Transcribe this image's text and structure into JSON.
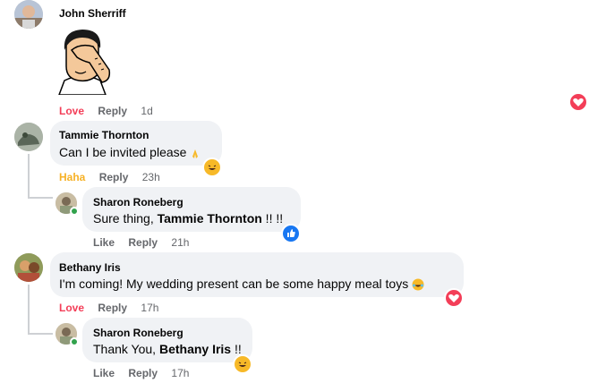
{
  "comments": [
    {
      "author": "John Sherriff",
      "actions": {
        "reaction": "Love",
        "reply": "Reply",
        "time": "1d"
      }
    },
    {
      "author": "Tammie Thornton",
      "text": "Can I be invited please",
      "actions": {
        "reaction": "Haha",
        "reply": "Reply",
        "time": "23h"
      },
      "reply": {
        "author": "Sharon Roneberg",
        "text_prefix": "Sure thing, ",
        "mention": "Tammie Thornton",
        "text_suffix": " !! !!",
        "actions": {
          "reaction": "Like",
          "reply": "Reply",
          "time": "21h"
        }
      }
    },
    {
      "author": "Bethany Iris",
      "text": "I'm coming! My wedding present can be some happy meal toys",
      "actions": {
        "reaction": "Love",
        "reply": "Reply",
        "time": "17h"
      },
      "reply": {
        "author": "Sharon Roneberg",
        "text_prefix": "Thank You, ",
        "mention": "Bethany Iris",
        "text_suffix": " !!",
        "actions": {
          "reaction": "Like",
          "reply": "Reply",
          "time": "17h"
        }
      }
    }
  ],
  "icons": {
    "sticker": "facepalm-sticker",
    "love": "heart-reaction-icon",
    "haha": "haha-reaction-icon",
    "like": "like-reaction-icon"
  },
  "colors": {
    "love": "#f33e58",
    "haha": "#f7b125",
    "like": "#1877f2",
    "bubble": "#f0f2f5",
    "meta": "#65676b"
  }
}
